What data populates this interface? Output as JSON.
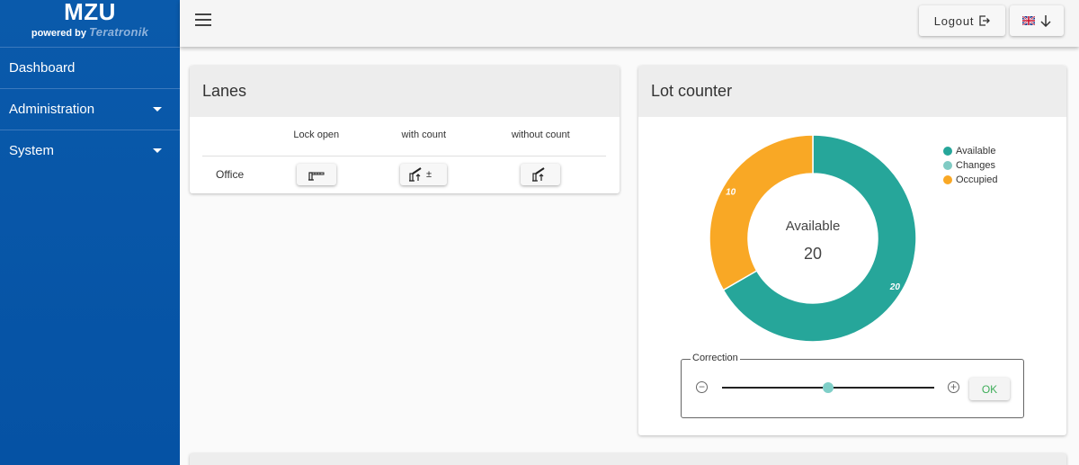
{
  "brand": {
    "title": "MZU",
    "powered_by": "powered by",
    "company": "Teratronik"
  },
  "sidebar": {
    "items": [
      {
        "label": "Dashboard",
        "expandable": false
      },
      {
        "label": "Administration",
        "expandable": true
      },
      {
        "label": "System",
        "expandable": true
      }
    ]
  },
  "topbar": {
    "logout_label": "Logout"
  },
  "lanes": {
    "title": "Lanes",
    "columns": [
      "",
      "Lock open",
      "with count",
      "without count"
    ],
    "rows": [
      {
        "name": "Office"
      }
    ]
  },
  "lot_counter": {
    "title": "Lot counter",
    "center_label": "Available",
    "center_value": "20",
    "legend": [
      {
        "label": "Available",
        "color": "#26a69a"
      },
      {
        "label": "Changes",
        "color": "#80cbc4"
      },
      {
        "label": "Occupied",
        "color": "#f9a825"
      }
    ],
    "correction_label": "Correction",
    "ok_label": "OK",
    "slider_level": 0.5
  },
  "chart_data": {
    "type": "pie",
    "categories": [
      "Available",
      "Changes",
      "Occupied"
    ],
    "values": [
      20,
      0,
      10
    ],
    "data_labels": [
      "20",
      "",
      "10"
    ],
    "colors": [
      "#26a69a",
      "#80cbc4",
      "#f9a825"
    ],
    "legend": "top-right",
    "donut": true
  }
}
